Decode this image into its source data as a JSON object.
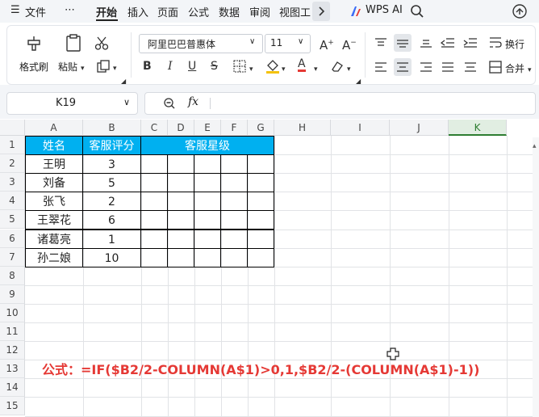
{
  "menubar": {
    "menu_icon": "☰",
    "file_label": "文件",
    "more_label": "⋯",
    "tabs": [
      "开始",
      "插入",
      "页面",
      "公式",
      "数据",
      "审阅",
      "视图",
      "工"
    ],
    "wps_ai_label": "WPS AI"
  },
  "ribbon": {
    "format_painter_label": "格式刷",
    "paste_label": "粘贴",
    "font_name": "阿里巴巴普惠体",
    "font_size": "11",
    "bold": "B",
    "italic": "I",
    "underline": "U",
    "wrap_label": "换行",
    "merge_label": "合并"
  },
  "formula_bar": {
    "cell_ref": "K19",
    "fx_label": "fx",
    "content": ""
  },
  "sheet": {
    "columns": [
      "A",
      "B",
      "C",
      "D",
      "E",
      "F",
      "G",
      "H",
      "I",
      "J",
      "K"
    ],
    "rows": [
      "1",
      "2",
      "3",
      "4",
      "5",
      "6",
      "7",
      "8",
      "9",
      "10",
      "11",
      "12",
      "13",
      "14",
      "15"
    ],
    "header_row": {
      "name": "姓名",
      "score": "客服评分",
      "stars": "客服星级"
    },
    "records": [
      {
        "name": "王明",
        "score": "3"
      },
      {
        "name": "刘备",
        "score": "5"
      },
      {
        "name": "张飞",
        "score": "2"
      },
      {
        "name": "王翠花",
        "score": "6"
      },
      {
        "name": "诸葛亮",
        "score": "1"
      },
      {
        "name": "孙二娘",
        "score": "10"
      }
    ],
    "formula_note": "公式：=IF($B2/2-COLUMN(A$1)>0,1,$B2/2-(COLUMN(A$1)-1))",
    "header_fill": "#00b0f0",
    "note_color": "#e53935",
    "active_column": "K"
  }
}
